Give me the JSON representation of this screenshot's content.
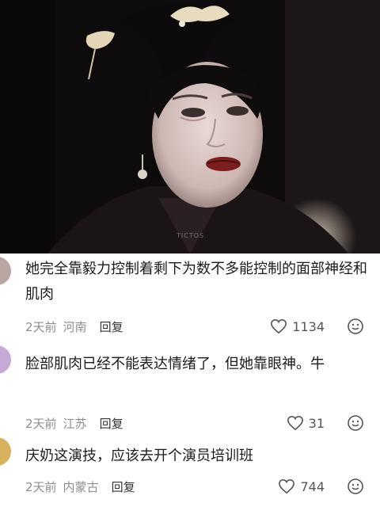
{
  "video": {
    "watermark": "TICTOS"
  },
  "comments": [
    {
      "text": "她完全靠毅力控制着剩下为数不多能控制的面部神经和肌肉",
      "time": "2天前",
      "location": "河南",
      "reply_label": "回复",
      "likes": "1134"
    },
    {
      "text": "脸部肌肉已经不能表达情绪了，但她靠眼神。牛",
      "time": "2天前",
      "location": "江苏",
      "reply_label": "回复",
      "likes": "31"
    },
    {
      "text": "庆奶这演技，应该去开个演员培训班",
      "time": "2天前",
      "location": "内蒙古",
      "reply_label": "回复",
      "likes": "744"
    }
  ],
  "icons": {
    "like": "heart-outline-icon",
    "emoji": "smiley-face-icon"
  },
  "colors": {
    "text": "#1b1b1b",
    "meta": "#8e8e8e",
    "icon": "#555555"
  }
}
